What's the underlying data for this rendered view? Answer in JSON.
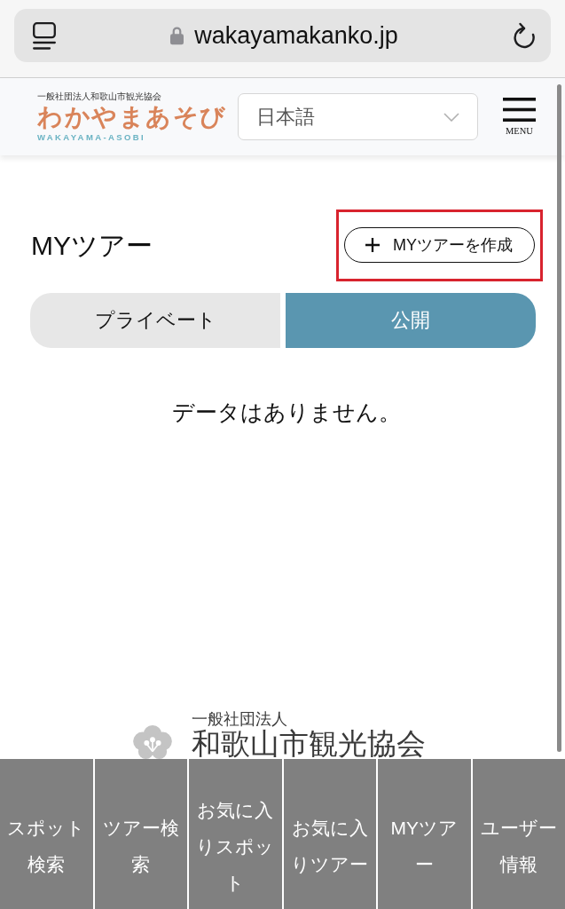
{
  "browser": {
    "url": "wakayamakanko.jp"
  },
  "header": {
    "logo": {
      "caption": "一般社団法人和歌山市観光協会",
      "title": "わかやまあそび",
      "subtitle": "WAKAYAMA-ASOBI"
    },
    "language_select": {
      "value": "日本語"
    },
    "menu_label": "MENU"
  },
  "page": {
    "title": "MYツアー",
    "create_button": {
      "label": "MYツアーを作成",
      "highlighted": true
    },
    "tabs": [
      {
        "label": "プライベート",
        "selected": false
      },
      {
        "label": "公開",
        "selected": true
      }
    ],
    "empty_message": "データはありません。"
  },
  "footer": {
    "caption": "一般社団法人",
    "name": "和歌山市観光協会"
  },
  "bottom_nav": [
    "スポット検索",
    "ツアー検索",
    "お気に入りスポット",
    "お気に入りツアー",
    "MYツアー",
    "ユーザー情報"
  ]
}
